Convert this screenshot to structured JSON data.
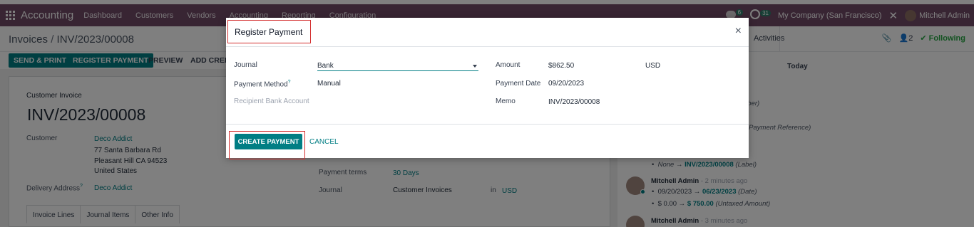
{
  "topnav": {
    "brand": "Accounting",
    "menu": [
      "Dashboard",
      "Customers",
      "Vendors",
      "Accounting",
      "Reporting",
      "Configuration"
    ],
    "chat_count": "6",
    "activity_count": "31",
    "company": "My Company (San Francisco)",
    "user": "Mitchell Admin"
  },
  "control": {
    "breadcrumb_root": "Invoices",
    "breadcrumb_sep": "/",
    "breadcrumb_current": "INV/2023/00008",
    "activities": "Activities",
    "followers_count": "2",
    "following": "Following"
  },
  "buttons": {
    "send_print": "SEND & PRINT",
    "register_payment": "REGISTER PAYMENT",
    "preview": "PREVIEW",
    "add_credit": "ADD CREDI"
  },
  "form": {
    "doc_type": "Customer Invoice",
    "number": "INV/2023/00008",
    "customer_label": "Customer",
    "customer_name": "Deco Addict",
    "address_line1": "77 Santa Barbara Rd",
    "address_line2": "Pleasant Hill CA 94523",
    "address_line3": "United States",
    "delivery_label": "Delivery Address",
    "delivery_value": "Deco Addict",
    "help_mark": "?",
    "payment_terms_label": "Payment terms",
    "payment_terms_value": "30 Days",
    "journal_label": "Journal",
    "journal_value": "Customer Invoices",
    "in_label": "in",
    "currency": "USD",
    "tabs": [
      "Invoice Lines",
      "Journal Items",
      "Other Info"
    ]
  },
  "chatter": {
    "today": "Today",
    "line_partial_1": "nber)",
    "line_partial_2": "(Payment Reference)",
    "change_label": {
      "old": "None",
      "new": "INV/2023/00008",
      "field": "(Label)"
    },
    "msg1": {
      "author": "Mitchell Admin",
      "time": "- 2 minutes ago",
      "old_date": "09/20/2023",
      "new_date": "06/23/2023",
      "date_field": "(Date)",
      "old_amount": "$ 0.00",
      "new_amount": "$ 750.00",
      "amount_field": "(Untaxed Amount)"
    },
    "msg2": {
      "author": "Mitchell Admin",
      "time": "- 3 minutes ago"
    },
    "arrow": "→"
  },
  "modal": {
    "title": "Register Payment",
    "close": "×",
    "journal_label": "Journal",
    "journal_value": "Bank",
    "payment_method_label": "Payment Method",
    "payment_method_help": "?",
    "payment_method_value": "Manual",
    "recipient_label": "Recipient Bank Account",
    "amount_label": "Amount",
    "amount_value": "$862.50",
    "amount_currency": "USD",
    "payment_date_label": "Payment Date",
    "payment_date_value": "09/20/2023",
    "memo_label": "Memo",
    "memo_value": "INV/2023/00008",
    "create_button": "CREATE PAYMENT",
    "cancel_button": "CANCEL"
  },
  "colors": {
    "nav": "#714b67",
    "primary": "#017e84",
    "highlight": "#d32f2f"
  }
}
